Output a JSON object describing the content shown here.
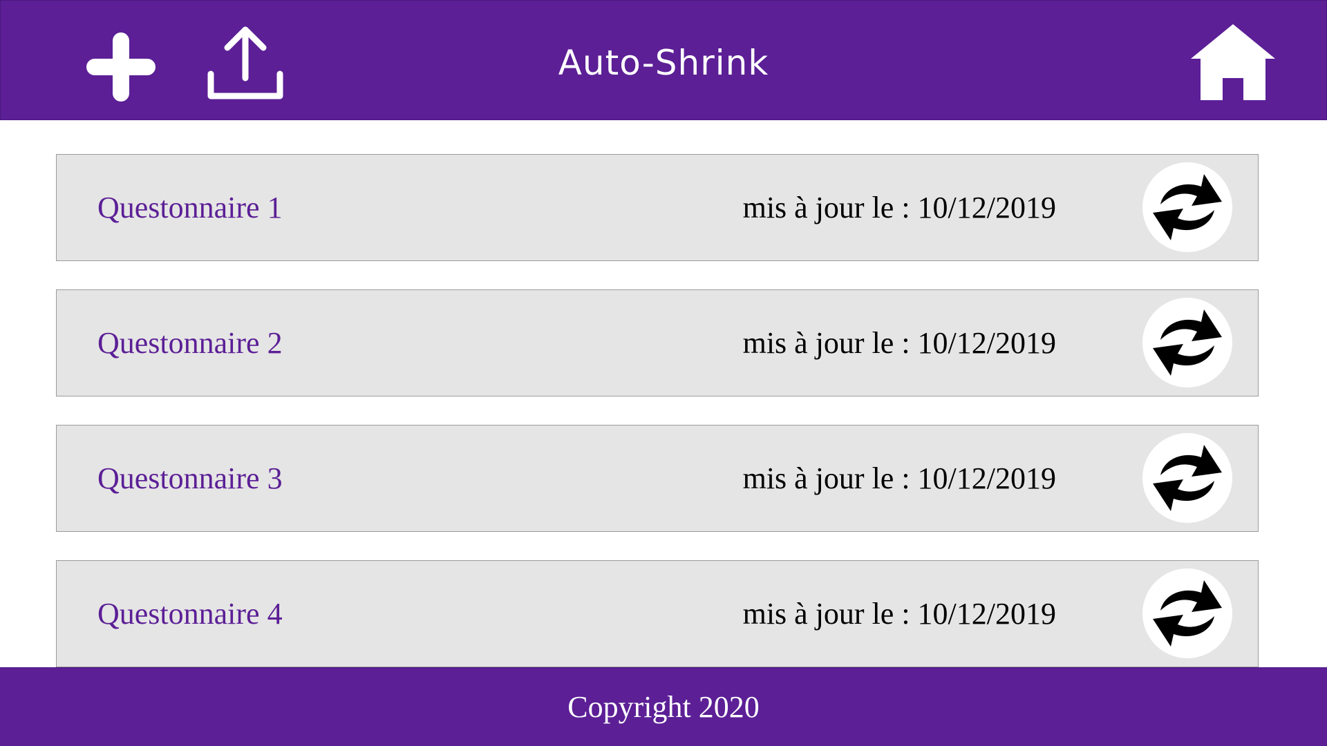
{
  "header": {
    "title": "Auto-Shrink",
    "add_icon": "plus-icon",
    "upload_icon": "upload-icon",
    "home_icon": "home-icon"
  },
  "questionnaires": [
    {
      "name": "Questonnaire 1",
      "updated": "mis à jour le : 10/12/2019",
      "action_icon": "refresh-icon"
    },
    {
      "name": "Questonnaire 2",
      "updated": "mis à jour le : 10/12/2019",
      "action_icon": "refresh-icon"
    },
    {
      "name": "Questonnaire 3",
      "updated": "mis à jour le : 10/12/2019",
      "action_icon": "refresh-icon"
    },
    {
      "name": "Questonnaire 4",
      "updated": "mis à jour le : 10/12/2019",
      "action_icon": "refresh-icon"
    }
  ],
  "footer": {
    "copyright": "Copyright 2020"
  },
  "colors": {
    "brand": "#5c1f96",
    "row_background": "#e5e5e5",
    "title_text": "#5c1f96",
    "header_text": "#ffffff"
  }
}
